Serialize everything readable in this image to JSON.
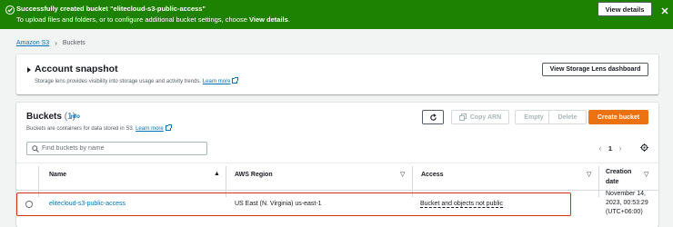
{
  "banner": {
    "title": "Successfully created bucket \"elitecloud-s3-public-access\"",
    "text_prefix": "To upload files and folders, or to configure additional bucket settings, choose",
    "text_bold": "View details",
    "text_suffix": ".",
    "button_label": "View details",
    "color": "#1d8102"
  },
  "breadcrumb": {
    "root": "Amazon S3",
    "current": "Buckets"
  },
  "snapshot": {
    "title": "Account snapshot",
    "description": "Storage lens provides visibility into storage usage and activity trends.",
    "learn_more": "Learn more",
    "button_label": "View Storage Lens dashboard"
  },
  "buckets": {
    "title": "Buckets",
    "count": "(1)",
    "info": "Info",
    "description": "Buckets are containers for data stored in S3.",
    "learn_more": "Learn more",
    "actions": {
      "copy_arn": "Copy ARN",
      "empty": "Empty",
      "delete": "Delete",
      "create": "Create bucket"
    },
    "search_placeholder": "Find buckets by name",
    "page": "1",
    "columns": {
      "name": "Name",
      "region": "AWS Region",
      "access": "Access",
      "creation": "Creation date"
    },
    "rows": [
      {
        "name": "elitecloud-s3-public-access",
        "region": "US East (N. Virginia) us-east-1",
        "access": "Bucket and objects not public",
        "created_line1": "November 14,",
        "created_line2": "2023, 00:53:29",
        "created_line3": "(UTC+06:00)"
      }
    ]
  },
  "colors": {
    "accent": "#ec7211",
    "link": "#0073bb",
    "highlight": "#d13212"
  }
}
